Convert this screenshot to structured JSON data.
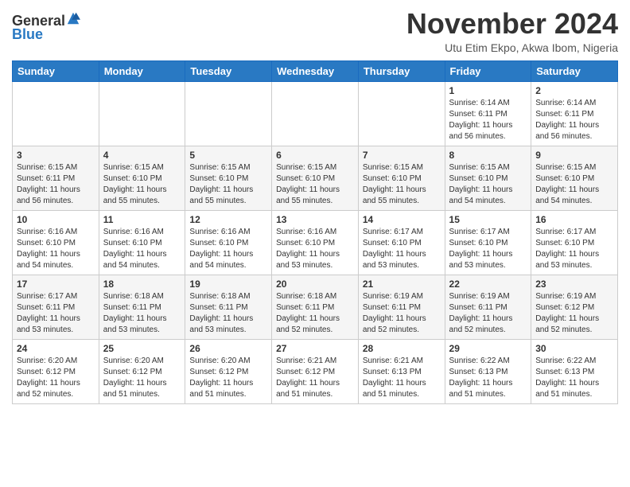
{
  "header": {
    "logo_general": "General",
    "logo_blue": "Blue",
    "month_title": "November 2024",
    "location": "Utu Etim Ekpo, Akwa Ibom, Nigeria"
  },
  "weekdays": [
    "Sunday",
    "Monday",
    "Tuesday",
    "Wednesday",
    "Thursday",
    "Friday",
    "Saturday"
  ],
  "weeks": [
    [
      {
        "day": "",
        "info": ""
      },
      {
        "day": "",
        "info": ""
      },
      {
        "day": "",
        "info": ""
      },
      {
        "day": "",
        "info": ""
      },
      {
        "day": "",
        "info": ""
      },
      {
        "day": "1",
        "info": "Sunrise: 6:14 AM\nSunset: 6:11 PM\nDaylight: 11 hours and 56 minutes."
      },
      {
        "day": "2",
        "info": "Sunrise: 6:14 AM\nSunset: 6:11 PM\nDaylight: 11 hours and 56 minutes."
      }
    ],
    [
      {
        "day": "3",
        "info": "Sunrise: 6:15 AM\nSunset: 6:11 PM\nDaylight: 11 hours and 56 minutes."
      },
      {
        "day": "4",
        "info": "Sunrise: 6:15 AM\nSunset: 6:10 PM\nDaylight: 11 hours and 55 minutes."
      },
      {
        "day": "5",
        "info": "Sunrise: 6:15 AM\nSunset: 6:10 PM\nDaylight: 11 hours and 55 minutes."
      },
      {
        "day": "6",
        "info": "Sunrise: 6:15 AM\nSunset: 6:10 PM\nDaylight: 11 hours and 55 minutes."
      },
      {
        "day": "7",
        "info": "Sunrise: 6:15 AM\nSunset: 6:10 PM\nDaylight: 11 hours and 55 minutes."
      },
      {
        "day": "8",
        "info": "Sunrise: 6:15 AM\nSunset: 6:10 PM\nDaylight: 11 hours and 54 minutes."
      },
      {
        "day": "9",
        "info": "Sunrise: 6:15 AM\nSunset: 6:10 PM\nDaylight: 11 hours and 54 minutes."
      }
    ],
    [
      {
        "day": "10",
        "info": "Sunrise: 6:16 AM\nSunset: 6:10 PM\nDaylight: 11 hours and 54 minutes."
      },
      {
        "day": "11",
        "info": "Sunrise: 6:16 AM\nSunset: 6:10 PM\nDaylight: 11 hours and 54 minutes."
      },
      {
        "day": "12",
        "info": "Sunrise: 6:16 AM\nSunset: 6:10 PM\nDaylight: 11 hours and 54 minutes."
      },
      {
        "day": "13",
        "info": "Sunrise: 6:16 AM\nSunset: 6:10 PM\nDaylight: 11 hours and 53 minutes."
      },
      {
        "day": "14",
        "info": "Sunrise: 6:17 AM\nSunset: 6:10 PM\nDaylight: 11 hours and 53 minutes."
      },
      {
        "day": "15",
        "info": "Sunrise: 6:17 AM\nSunset: 6:10 PM\nDaylight: 11 hours and 53 minutes."
      },
      {
        "day": "16",
        "info": "Sunrise: 6:17 AM\nSunset: 6:10 PM\nDaylight: 11 hours and 53 minutes."
      }
    ],
    [
      {
        "day": "17",
        "info": "Sunrise: 6:17 AM\nSunset: 6:11 PM\nDaylight: 11 hours and 53 minutes."
      },
      {
        "day": "18",
        "info": "Sunrise: 6:18 AM\nSunset: 6:11 PM\nDaylight: 11 hours and 53 minutes."
      },
      {
        "day": "19",
        "info": "Sunrise: 6:18 AM\nSunset: 6:11 PM\nDaylight: 11 hours and 53 minutes."
      },
      {
        "day": "20",
        "info": "Sunrise: 6:18 AM\nSunset: 6:11 PM\nDaylight: 11 hours and 52 minutes."
      },
      {
        "day": "21",
        "info": "Sunrise: 6:19 AM\nSunset: 6:11 PM\nDaylight: 11 hours and 52 minutes."
      },
      {
        "day": "22",
        "info": "Sunrise: 6:19 AM\nSunset: 6:11 PM\nDaylight: 11 hours and 52 minutes."
      },
      {
        "day": "23",
        "info": "Sunrise: 6:19 AM\nSunset: 6:12 PM\nDaylight: 11 hours and 52 minutes."
      }
    ],
    [
      {
        "day": "24",
        "info": "Sunrise: 6:20 AM\nSunset: 6:12 PM\nDaylight: 11 hours and 52 minutes."
      },
      {
        "day": "25",
        "info": "Sunrise: 6:20 AM\nSunset: 6:12 PM\nDaylight: 11 hours and 51 minutes."
      },
      {
        "day": "26",
        "info": "Sunrise: 6:20 AM\nSunset: 6:12 PM\nDaylight: 11 hours and 51 minutes."
      },
      {
        "day": "27",
        "info": "Sunrise: 6:21 AM\nSunset: 6:12 PM\nDaylight: 11 hours and 51 minutes."
      },
      {
        "day": "28",
        "info": "Sunrise: 6:21 AM\nSunset: 6:13 PM\nDaylight: 11 hours and 51 minutes."
      },
      {
        "day": "29",
        "info": "Sunrise: 6:22 AM\nSunset: 6:13 PM\nDaylight: 11 hours and 51 minutes."
      },
      {
        "day": "30",
        "info": "Sunrise: 6:22 AM\nSunset: 6:13 PM\nDaylight: 11 hours and 51 minutes."
      }
    ]
  ]
}
